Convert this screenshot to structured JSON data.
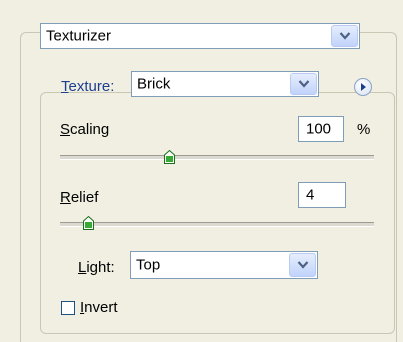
{
  "filter": {
    "selected": "Texturizer",
    "icon": "chevron-down-icon"
  },
  "texture": {
    "label_prefix": "T",
    "label_rest": "exture:",
    "selected": "Brick",
    "menu_icon": "play-arrow-icon"
  },
  "scaling": {
    "label_prefix": "S",
    "label_rest": "caling",
    "value": "100",
    "unit": "%",
    "slider_fraction": 0.35
  },
  "relief": {
    "label_prefix": "R",
    "label_rest": "elief",
    "value": "4",
    "slider_fraction": 0.09
  },
  "light": {
    "label_prefix": "L",
    "label_rest": "ight:",
    "selected": "Top"
  },
  "invert": {
    "label_prefix": "I",
    "label_rest": "nvert",
    "checked": false
  },
  "colors": {
    "panel_background": "#f1efe2",
    "input_border": "#7f9db9",
    "dropdown_button": "#c1d3fb"
  }
}
